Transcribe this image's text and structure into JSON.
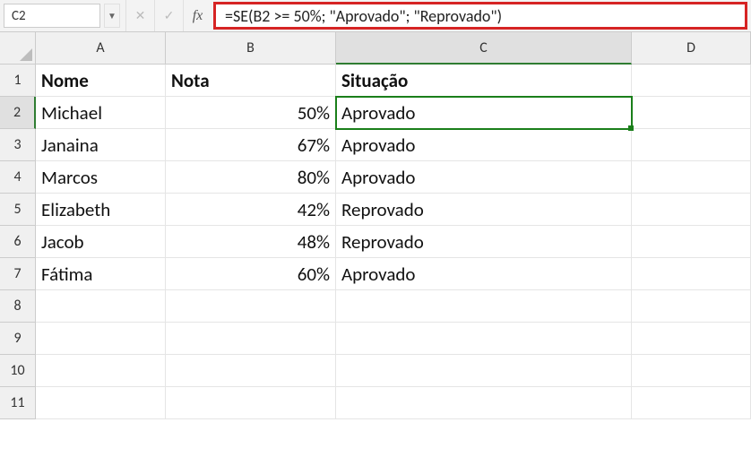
{
  "name_box": "C2",
  "formula": "=SE(B2 >= 50%; \"Aprovado\"; \"Reprovado\")",
  "columns": [
    "A",
    "B",
    "C",
    "D"
  ],
  "rows": [
    "1",
    "2",
    "3",
    "4",
    "5",
    "6",
    "7",
    "8",
    "9",
    "10",
    "11"
  ],
  "active_col": "C",
  "active_row": "2",
  "headers": {
    "A": "Nome",
    "B": "Nota",
    "C": "Situação"
  },
  "data": [
    {
      "nome": "Michael",
      "nota": "50%",
      "situacao": "Aprovado"
    },
    {
      "nome": "Janaina",
      "nota": "67%",
      "situacao": "Aprovado"
    },
    {
      "nome": "Marcos",
      "nota": "80%",
      "situacao": "Aprovado"
    },
    {
      "nome": "Elizabeth",
      "nota": "42%",
      "situacao": "Reprovado"
    },
    {
      "nome": "Jacob",
      "nota": "48%",
      "situacao": "Reprovado"
    },
    {
      "nome": "Fátima",
      "nota": "60%",
      "situacao": "Aprovado"
    }
  ],
  "fx_label": "fx"
}
